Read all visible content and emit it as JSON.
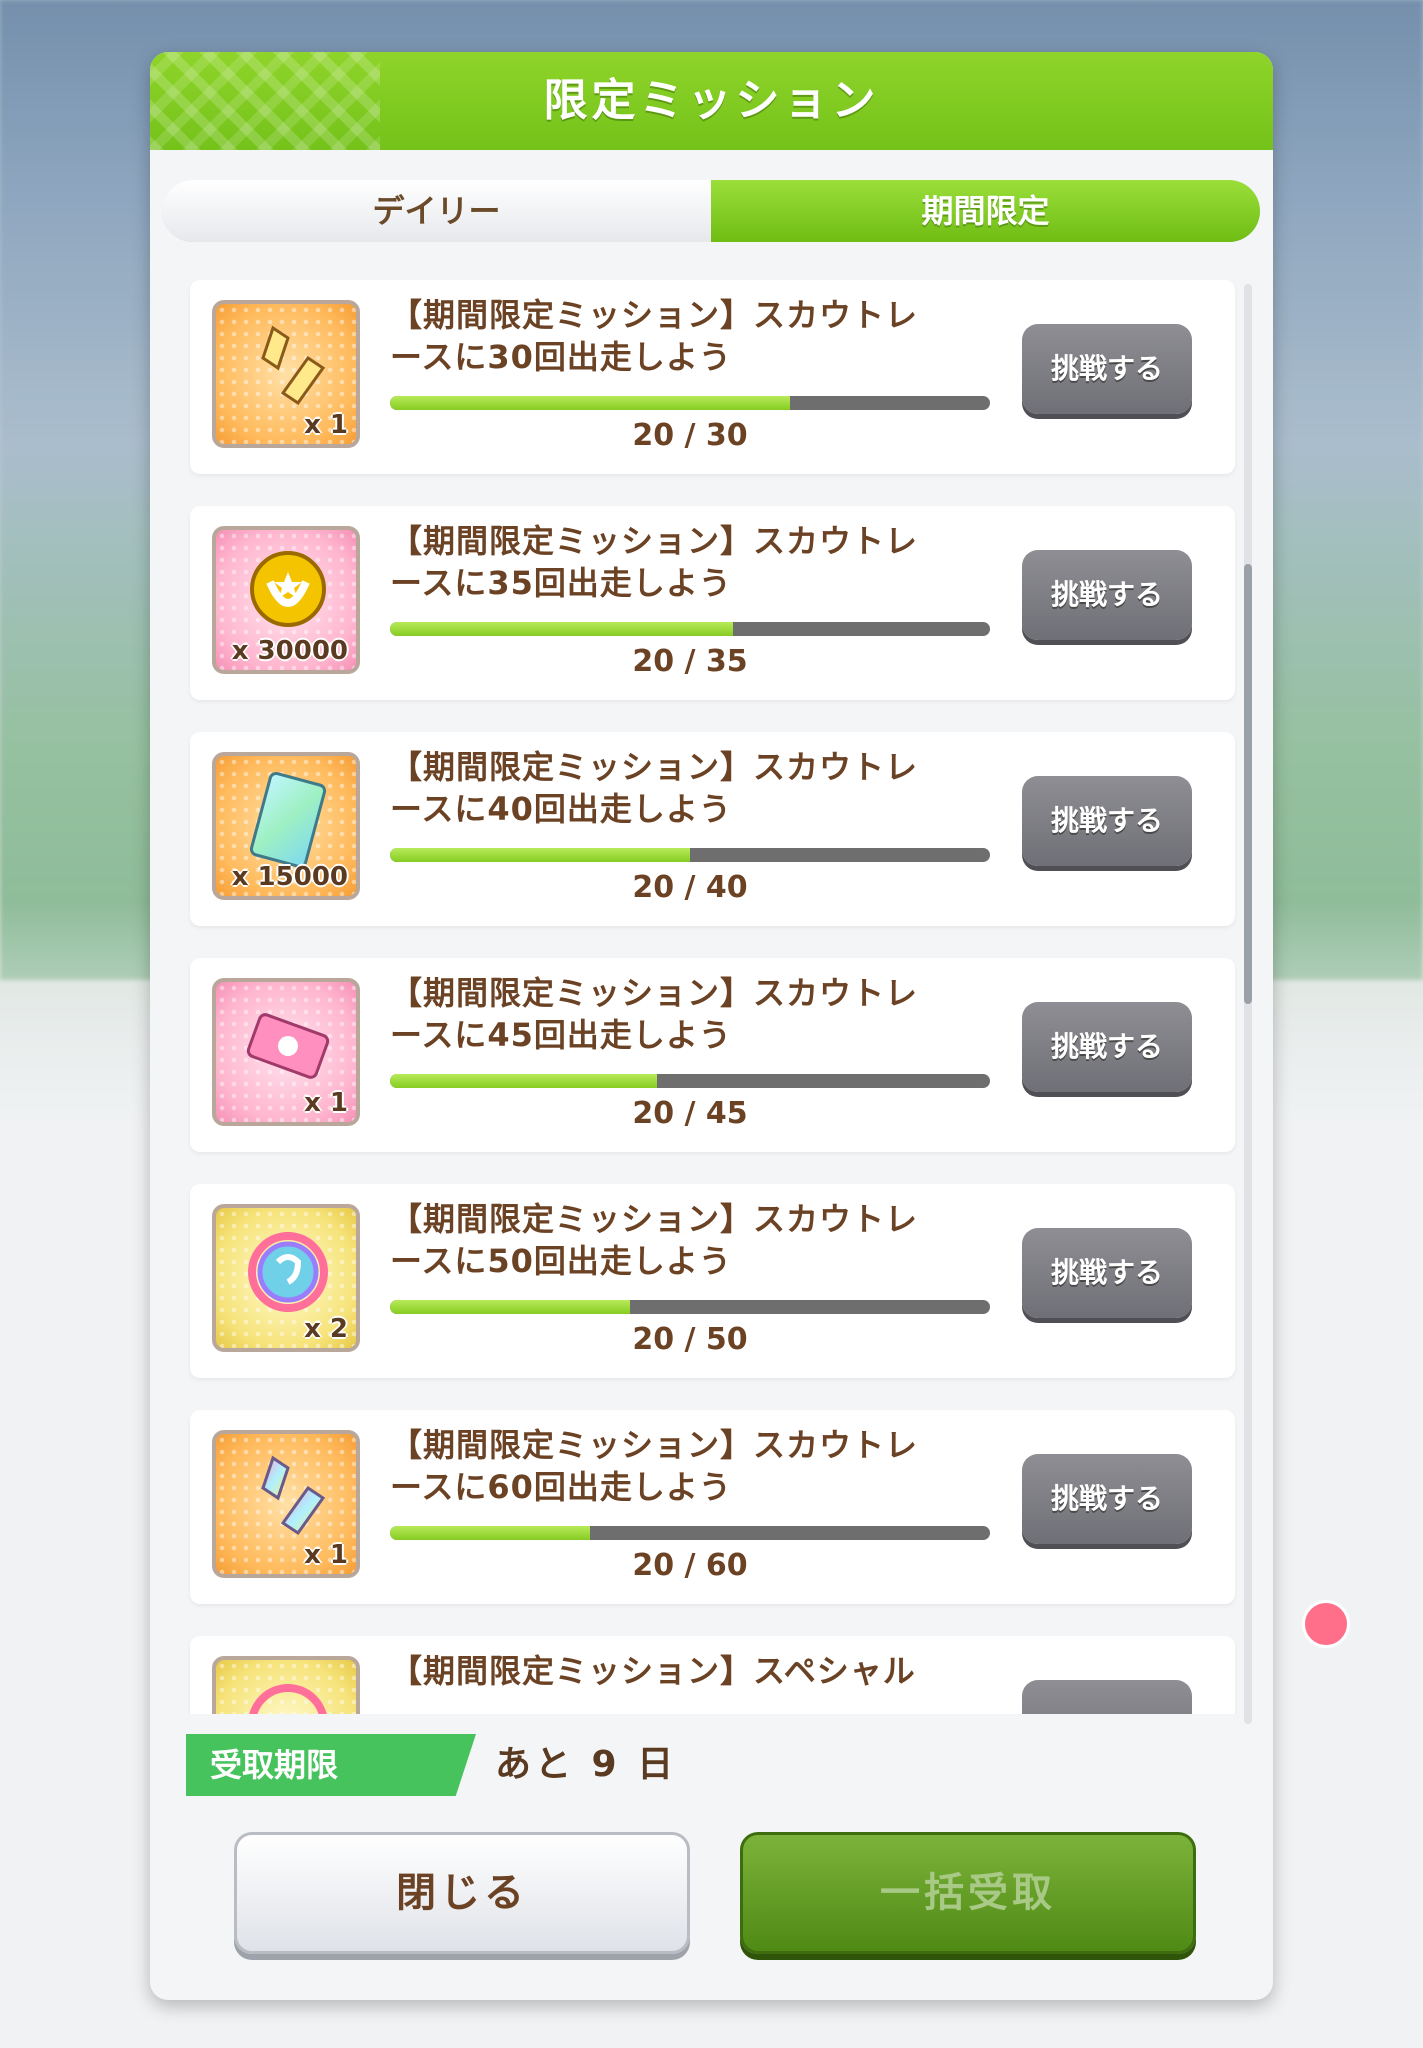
{
  "dialog": {
    "title": "限定ミッション",
    "tabs": [
      {
        "label": "デイリー",
        "active": false
      },
      {
        "label": "期間限定",
        "active": true
      }
    ],
    "missions": [
      {
        "title_line1": "【期間限定ミッション】スカウトレ",
        "title_line2": "ースに30回出走しよう",
        "progress_text": "20 / 30",
        "progress": 0.6667,
        "reward_qty": "x 1",
        "reward_icon": "crystal-icon",
        "button": "挑戦する"
      },
      {
        "title_line1": "【期間限定ミッション】スカウトレ",
        "title_line2": "ースに35回出走しよう",
        "progress_text": "20 / 35",
        "progress": 0.5714,
        "reward_qty": "x 30000",
        "reward_icon": "gold-coin-icon",
        "button": "挑戦する"
      },
      {
        "title_line1": "【期間限定ミッション】スカウトレ",
        "title_line2": "ースに40回出走しよう",
        "progress_text": "20 / 40",
        "progress": 0.5,
        "reward_qty": "x 15000",
        "reward_icon": "rainbow-ticket-icon",
        "button": "挑戦する"
      },
      {
        "title_line1": "【期間限定ミッション】スカウトレ",
        "title_line2": "ースに45回出走しよう",
        "progress_text": "20 / 45",
        "progress": 0.4444,
        "reward_qty": "x 1",
        "reward_icon": "pink-ticket-icon",
        "button": "挑戦する"
      },
      {
        "title_line1": "【期間限定ミッション】スカウトレ",
        "title_line2": "ースに50回出走しよう",
        "progress_text": "20 / 50",
        "progress": 0.4,
        "reward_qty": "x 2",
        "reward_icon": "rainbow-clock-icon",
        "button": "挑戦する"
      },
      {
        "title_line1": "【期間限定ミッション】スカウトレ",
        "title_line2": "ースに60回出走しよう",
        "progress_text": "20 / 60",
        "progress": 0.3333,
        "reward_qty": "x 1",
        "reward_icon": "rainbow-crystal-icon",
        "button": "挑戦する"
      },
      {
        "title_line1": "【期間限定ミッション】スペシャル",
        "title_line2": "",
        "progress_text": "",
        "progress": 0,
        "reward_qty": "",
        "reward_icon": "rainbow-clock-icon",
        "button": ""
      }
    ],
    "deadline_label": "受取期限",
    "deadline_value": "あと 9 日",
    "close_button": "閉じる",
    "claim_all_button": "一括受取"
  },
  "colors": {
    "header_green": "#7fcb20",
    "progress_fill": "#9ad83a",
    "text_brown": "#6b4224",
    "deadline_green": "#46c35c",
    "claim_disabled": "#5f9a22"
  }
}
